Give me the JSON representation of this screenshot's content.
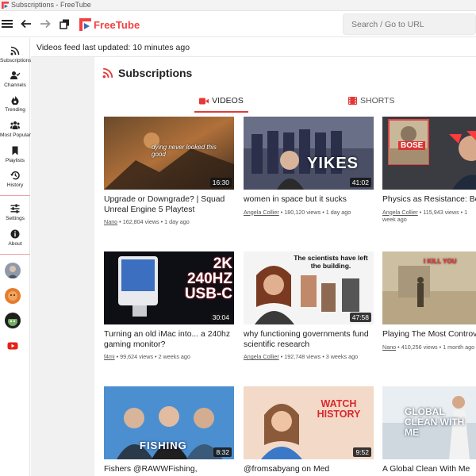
{
  "window": {
    "title": "Subscriptions - FreeTube"
  },
  "app": {
    "logo_text": "FreeTube",
    "brand_color": "#f04242"
  },
  "search": {
    "placeholder": "Search / Go to URL",
    "value": ""
  },
  "sidebar": {
    "items": [
      {
        "label": "Subscriptions",
        "icon": "rss-icon"
      },
      {
        "label": "Channels",
        "icon": "users-check-icon"
      },
      {
        "label": "Trending",
        "icon": "fire-icon"
      },
      {
        "label": "Most Popular",
        "icon": "users-icon"
      },
      {
        "label": "Playlists",
        "icon": "bookmark-icon"
      },
      {
        "label": "History",
        "icon": "history-icon"
      },
      {
        "label": "Settings",
        "icon": "sliders-icon"
      },
      {
        "label": "About",
        "icon": "info-icon"
      }
    ],
    "channels": [
      "channel-avatar-1",
      "channel-avatar-2",
      "channel-avatar-3",
      "channel-avatar-4"
    ]
  },
  "status": {
    "text": "Videos feed last updated: 10 minutes ago"
  },
  "page": {
    "title": "Subscriptions"
  },
  "tabs": [
    {
      "label": "VIDEOS",
      "active": true
    },
    {
      "label": "SHORTS",
      "active": false
    }
  ],
  "videos": [
    {
      "title": "Upgrade or Downgrade? | Squad Unreal Engine 5 Playtest",
      "channel": "Nano",
      "meta": " • 162,804 views • 1 day ago",
      "duration": "16:30",
      "overlay": "dying never looked this good"
    },
    {
      "title": "women in space but it sucks",
      "channel": "Angela Collier",
      "meta": " • 180,120 views • 1 day ago",
      "duration": "41:02",
      "overlay": "YIKES"
    },
    {
      "title": "Physics as Resistance: Bose-Einstein Condensates",
      "channel": "Angela Collier",
      "meta": " • 115,943 views • 1 week ago",
      "duration": "",
      "overlay": "BOSE"
    },
    {
      "title": "Turning an old iMac into... a 240hz gaming monitor?",
      "channel": "f4mi",
      "meta": " • 99,624 views • 2 weeks ago",
      "duration": "30:04",
      "overlay": "2K 240HZ USB-C"
    },
    {
      "title": "why functioning governments fund scientific research",
      "channel": "Angela Collier",
      "meta": " • 192,748 views • 3 weeks ago",
      "duration": "47:58",
      "overlay": "The scientists have left the building."
    },
    {
      "title": "Playing The Most Controversial Squad Mods (This video might get deleted!)",
      "channel": "Nano",
      "meta": " • 410,256 views • 1 month ago",
      "duration": "",
      "overlay": "I KILL YOU"
    },
    {
      "title": "Fishers @RAWWFishing,",
      "channel": "",
      "meta": "",
      "duration": "8:32",
      "overlay": "FISHING"
    },
    {
      "title": "@fromsabyang on Med",
      "channel": "",
      "meta": "",
      "duration": "9:52",
      "overlay": "WATCH HISTORY"
    },
    {
      "title": "A Global Clean With Me",
      "channel": "",
      "meta": "",
      "duration": "",
      "overlay": "GLOBAL CLEAN WITH ME"
    }
  ]
}
